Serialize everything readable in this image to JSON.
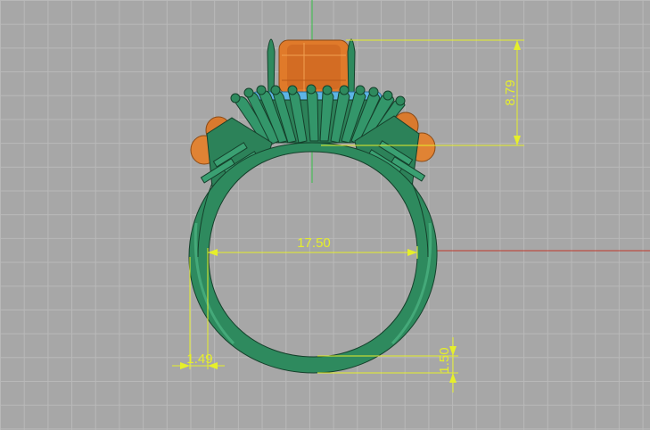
{
  "viewport": {
    "background": "#a7a7a7",
    "grid_color": "#b9b9b9",
    "axis_x_color": "#c0392b",
    "axis_y_color": "#38c048"
  },
  "model": {
    "metal_color": "#2e8a5e",
    "metal_dark": "#1e5e40",
    "gem_orange": "#e07a2a",
    "gem_blue": "#5db4e6"
  },
  "dimensions": {
    "color": "#e6ef2a",
    "ring_inner_diameter": "17.50",
    "head_height": "8.79",
    "band_width_left": "1.49",
    "band_thickness_bottom": "1.50"
  }
}
